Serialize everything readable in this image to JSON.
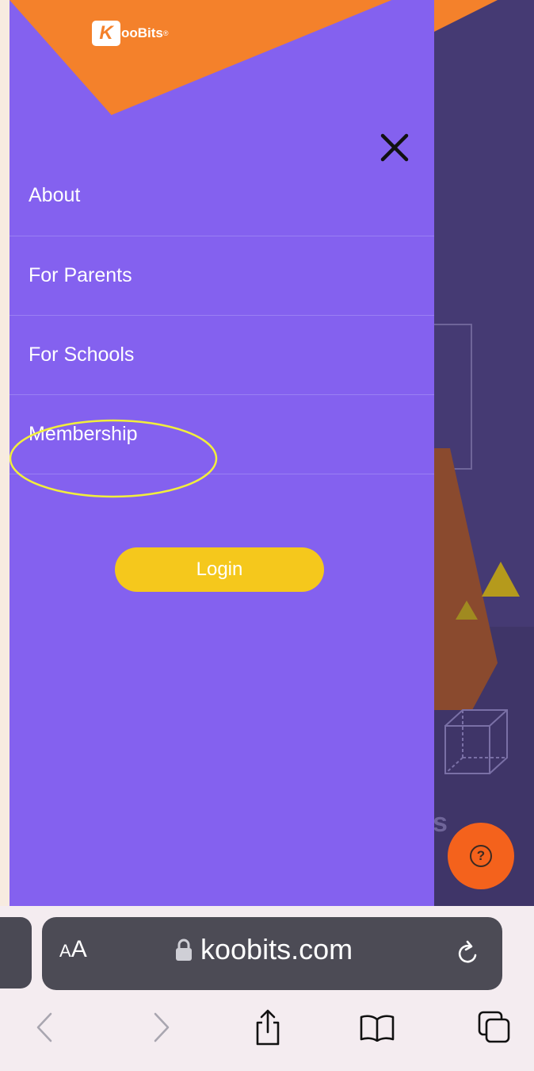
{
  "brand": {
    "logo_mark": "K",
    "logo_text": "ooBits",
    "logo_sup": "®"
  },
  "menu": {
    "items": [
      {
        "label": "About"
      },
      {
        "label": "For Parents"
      },
      {
        "label": "For Schools"
      },
      {
        "label": "Membership"
      }
    ],
    "login_label": "Login",
    "close_icon": "close-icon"
  },
  "background_page": {
    "visible_letter": "s",
    "help_icon": "question-icon",
    "help_symbol": "?"
  },
  "browser": {
    "aa_small": "A",
    "aa_large": "A",
    "url": "koobits.com",
    "icons": [
      "back-icon",
      "forward-icon",
      "share-icon",
      "bookmarks-icon",
      "tabs-icon",
      "reload-icon",
      "lock-icon"
    ]
  },
  "colors": {
    "menu_bg": "#8461ef",
    "accent_orange": "#f4812b",
    "login_yellow": "#f5c81c",
    "annotation": "#f2ef3b"
  }
}
